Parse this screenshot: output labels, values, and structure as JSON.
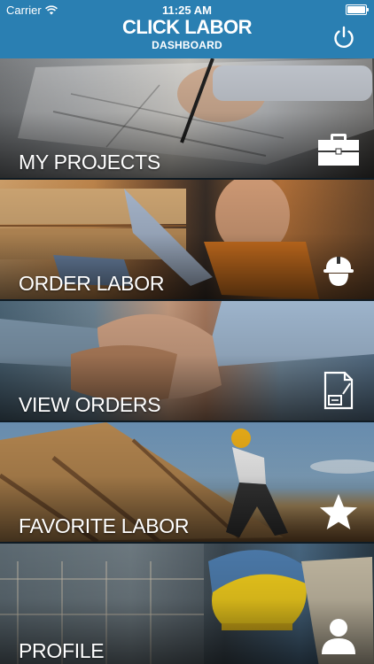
{
  "status": {
    "carrier": "Carrier",
    "time": "11:25 AM",
    "battery_level": 1.0
  },
  "header": {
    "title": "CLICK LABOR",
    "subtitle": "DASHBOARD",
    "logout_icon": "power-icon"
  },
  "menu": {
    "items": [
      {
        "label": "MY PROJECTS",
        "icon": "briefcase-icon"
      },
      {
        "label": "ORDER LABOR",
        "icon": "hardhat-icon"
      },
      {
        "label": "VIEW ORDERS",
        "icon": "document-icon"
      },
      {
        "label": "FAVORITE LABOR",
        "icon": "star-icon"
      },
      {
        "label": "PROFILE",
        "icon": "person-icon"
      }
    ]
  },
  "colors": {
    "header": "#2a7fb2",
    "text": "#ffffff"
  }
}
